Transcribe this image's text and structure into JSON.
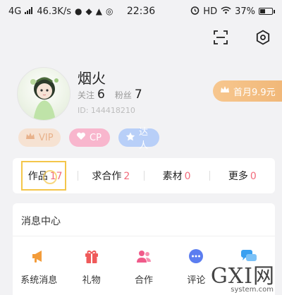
{
  "status_bar": {
    "network": "4G",
    "speed": "46.3K/s",
    "time": "22:36",
    "hd": "HD",
    "battery": "37%"
  },
  "top_icons": [
    "scan-icon",
    "settings-icon"
  ],
  "profile": {
    "nickname": "烟火",
    "follow_label": "关注",
    "follow_count": "6",
    "fans_label": "粉丝",
    "fans_count": "7",
    "user_id": "ID: 144418210",
    "promo_label": "首月9.9元"
  },
  "badges": [
    {
      "label": "VIP",
      "icon": "crown-icon",
      "color": "#f6e2d2"
    },
    {
      "label": "CP",
      "icon": "heart-icon",
      "color": "#f8b6cd"
    },
    {
      "label": "达人",
      "icon": "star-icon",
      "color": "#b8cff8"
    }
  ],
  "tabs": [
    {
      "label": "作品",
      "count": "17"
    },
    {
      "label": "求合作",
      "count": "2"
    },
    {
      "label": "素材",
      "count": "0"
    },
    {
      "label": "更多",
      "count": "0"
    }
  ],
  "messages": {
    "title": "消息中心",
    "items": [
      {
        "label": "系统消息",
        "icon": "megaphone-icon",
        "color": "#f39c3a"
      },
      {
        "label": "礼物",
        "icon": "gift-icon",
        "color": "#ef5a5a"
      },
      {
        "label": "合作",
        "icon": "users-icon",
        "color": "#f05a8a"
      },
      {
        "label": "评论",
        "icon": "comment-icon",
        "color": "#5b7df0"
      },
      {
        "label": "",
        "icon": "chat-icon",
        "color": "#3aa0f0"
      }
    ]
  },
  "watermark": {
    "main": "GXI网",
    "sub": "system.com"
  },
  "colors": {
    "accent_pink": "#f26b7b",
    "highlight_yellow": "#f4c64a"
  }
}
